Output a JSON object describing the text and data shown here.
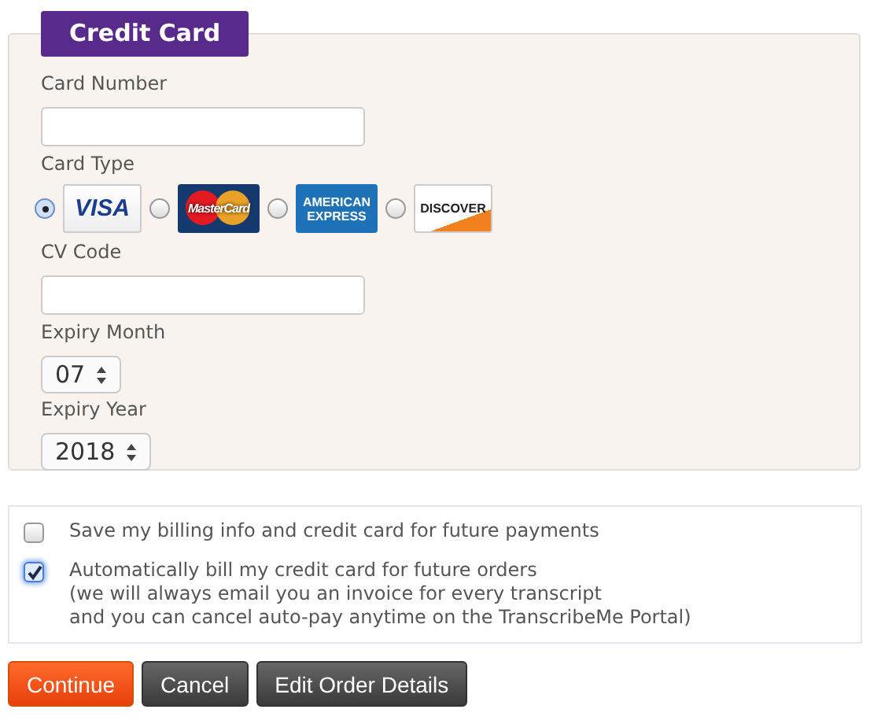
{
  "legend": "Credit Card",
  "fields": [
    {
      "kind": "text",
      "label": "Card Number"
    },
    {
      "kind": "cards",
      "label": "Card Type",
      "cards": [
        {
          "kind": "visa",
          "text": "VISA",
          "selected": true
        },
        {
          "kind": "mastercard",
          "text": "MasterCard",
          "selected": false
        },
        {
          "kind": "amex",
          "text": "AMERICAN\nEXPRESS",
          "selected": false
        },
        {
          "kind": "discover",
          "text": "DISCOVER",
          "selected": false
        }
      ]
    },
    {
      "kind": "text",
      "label": "CV Code"
    },
    {
      "kind": "select",
      "label": "Expiry Month",
      "value": "07"
    },
    {
      "kind": "select",
      "label": "Expiry Year",
      "value": "2018"
    }
  ],
  "options": [
    {
      "label": "Save my billing info and credit card for future payments",
      "checked": false
    },
    {
      "label": "Automatically bill my credit card for future orders\n(we will always email you an invoice for every transcript\nand you can cancel auto-pay anytime on the TranscribeMe Portal)",
      "checked": true
    }
  ],
  "buttons": [
    {
      "label": "Continue",
      "kind": "primary"
    },
    {
      "label": "Cancel",
      "kind": "dark"
    },
    {
      "label": "Edit Order Details",
      "kind": "dark"
    }
  ]
}
